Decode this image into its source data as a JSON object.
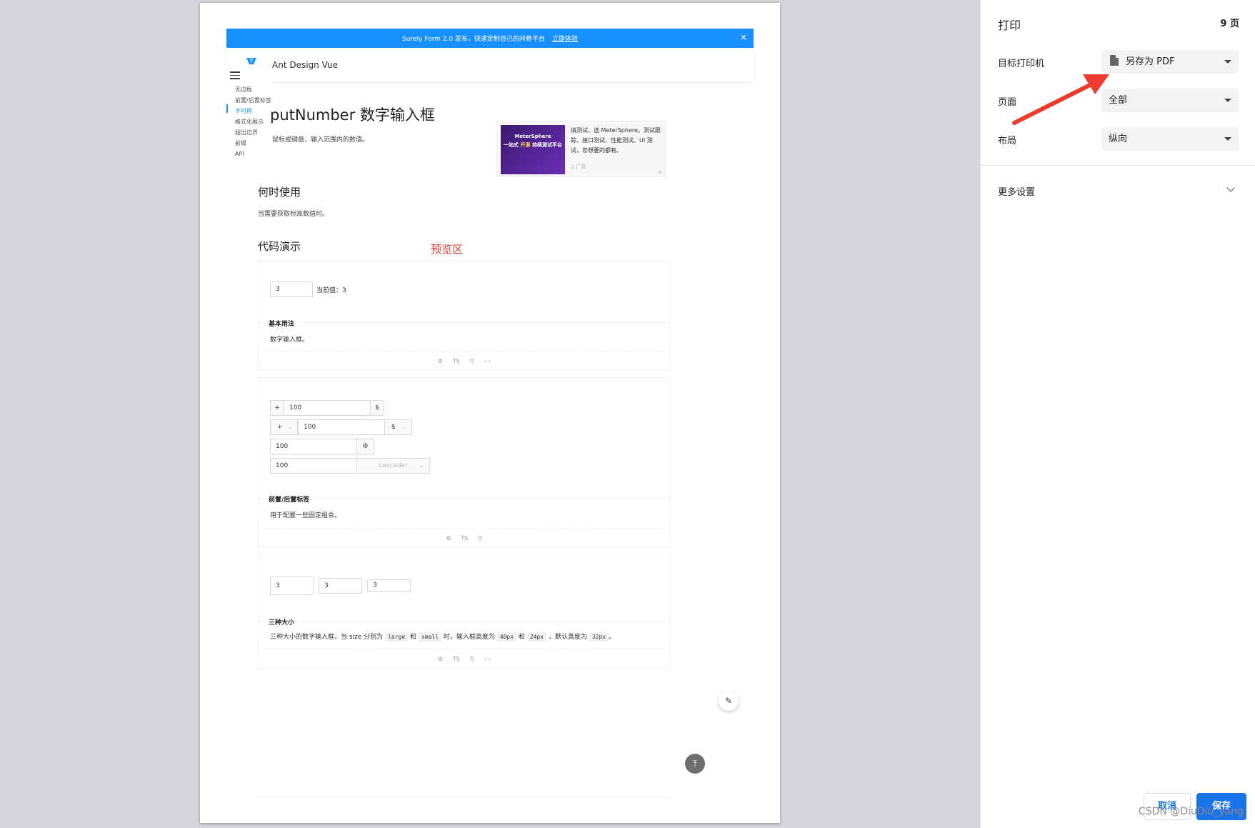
{
  "banner": {
    "text": "Surely Form 2.0 发布，快速定制自己的问卷平台",
    "link": "立即体验",
    "close": "×"
  },
  "site": {
    "name": "Ant Design Vue"
  },
  "nav": {
    "items": [
      "无边框",
      "前置/后置标签",
      "不可用",
      "格式化展示",
      "超出边界",
      "前缀",
      "API"
    ]
  },
  "doc": {
    "title": "putNumber  数字输入框",
    "desc": "鼠标或键盘，输入范围内的数值。",
    "when_title": "何时使用",
    "when_desc": "当需要获取标准数值时。",
    "demo_title": "代码演示",
    "preview_label": "预览区"
  },
  "ad": {
    "image_text1": "MeterSphere",
    "image_text2a": "一站式",
    "image_text2b": "开源",
    "image_text2c": "持续测试平台",
    "text": "搞测试，选 MeterSphere。测试跟踪、接口测试、性能测试、UI 测试，您想要的都有。",
    "tag": "△ 广告",
    "close": "×"
  },
  "demo1": {
    "value": "3",
    "current": "当前值：3",
    "title": "基本用法",
    "desc": "数字输入框。"
  },
  "demo2": {
    "prefix_plus": "+",
    "value1": "100",
    "suffix_dollar": "$",
    "select_plus": "+",
    "value2": "100",
    "select_dollar": "$",
    "value3": "100",
    "value4": "100",
    "cascader": "cascader",
    "title": "前置/后置标签",
    "desc": "用于配置一些固定组合。"
  },
  "demo3": {
    "large": "3",
    "default": "3",
    "small": "3",
    "title": "三种大小",
    "desc_parts": [
      "三种大小的数字输入框，当 size 分别为",
      "large",
      "和",
      "small",
      "时，输入框高度为",
      "40px",
      "和",
      "24px",
      "，默认高度为",
      "32px",
      "。"
    ]
  },
  "actions": {
    "ts": "TS",
    "code": "‹ ›",
    "gear": "⚙",
    "copy": "⎘"
  },
  "print": {
    "title": "打印",
    "pages": "9 页",
    "printer_label": "目标打印机",
    "printer_value": "另存为 PDF",
    "pages_label": "页面",
    "pages_value": "全部",
    "layout_label": "布局",
    "layout_value": "纵向",
    "more_settings": "更多设置",
    "cancel": "取消",
    "save": "保存"
  },
  "watermark": "CSDN @DiuDiu_yang",
  "colors": {
    "primary": "#1890ff",
    "chrome_blue": "#1a73e8",
    "annotation_red": "#e53935"
  }
}
